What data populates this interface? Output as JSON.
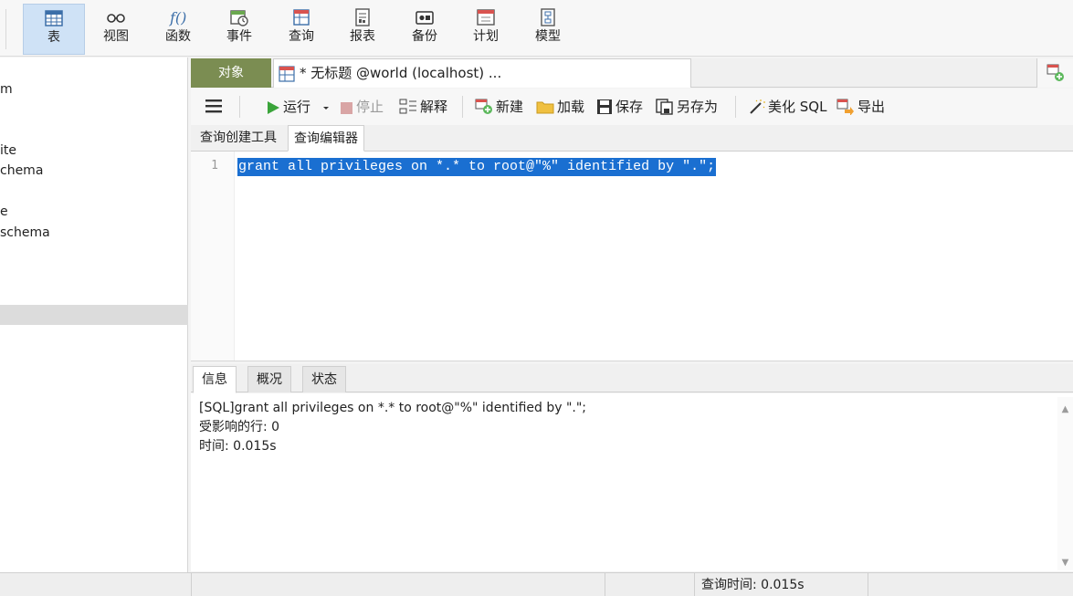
{
  "toolbar": {
    "items": [
      {
        "label": "表",
        "icon": "table-icon",
        "active": true
      },
      {
        "label": "视图",
        "icon": "view-icon"
      },
      {
        "label": "函数",
        "icon": "function-icon"
      },
      {
        "label": "事件",
        "icon": "event-icon"
      },
      {
        "label": "查询",
        "icon": "query-icon"
      },
      {
        "label": "报表",
        "icon": "report-icon"
      },
      {
        "label": "备份",
        "icon": "backup-icon"
      },
      {
        "label": "计划",
        "icon": "schedule-icon"
      },
      {
        "label": "模型",
        "icon": "model-icon"
      }
    ]
  },
  "tree": {
    "items": [
      "m",
      "ite",
      "chema",
      "e",
      "schema"
    ]
  },
  "tabs": {
    "objects_label": "对象",
    "query_tab_label": "* 无标题 @world (localhost) ..."
  },
  "query_toolbar": {
    "run": "运行",
    "stop": "停止",
    "explain": "解释",
    "new": "新建",
    "load": "加载",
    "save": "保存",
    "save_as": "另存为",
    "beautify": "美化 SQL",
    "export": "导出"
  },
  "sub_tabs": {
    "builder": "查询创建工具",
    "editor": "查询编辑器"
  },
  "editor": {
    "line_number": "1",
    "code": "grant all privileges on *.* to root@\"%\" identified by \".\";"
  },
  "result_tabs": {
    "info": "信息",
    "overview": "概况",
    "status": "状态"
  },
  "result": {
    "line1": "[SQL]grant all privileges on *.* to root@\"%\" identified by \".\";",
    "line2": "受影响的行: 0",
    "line3": "时间: 0.015s"
  },
  "status_bar": {
    "query_time": "查询时间: 0.015s"
  }
}
